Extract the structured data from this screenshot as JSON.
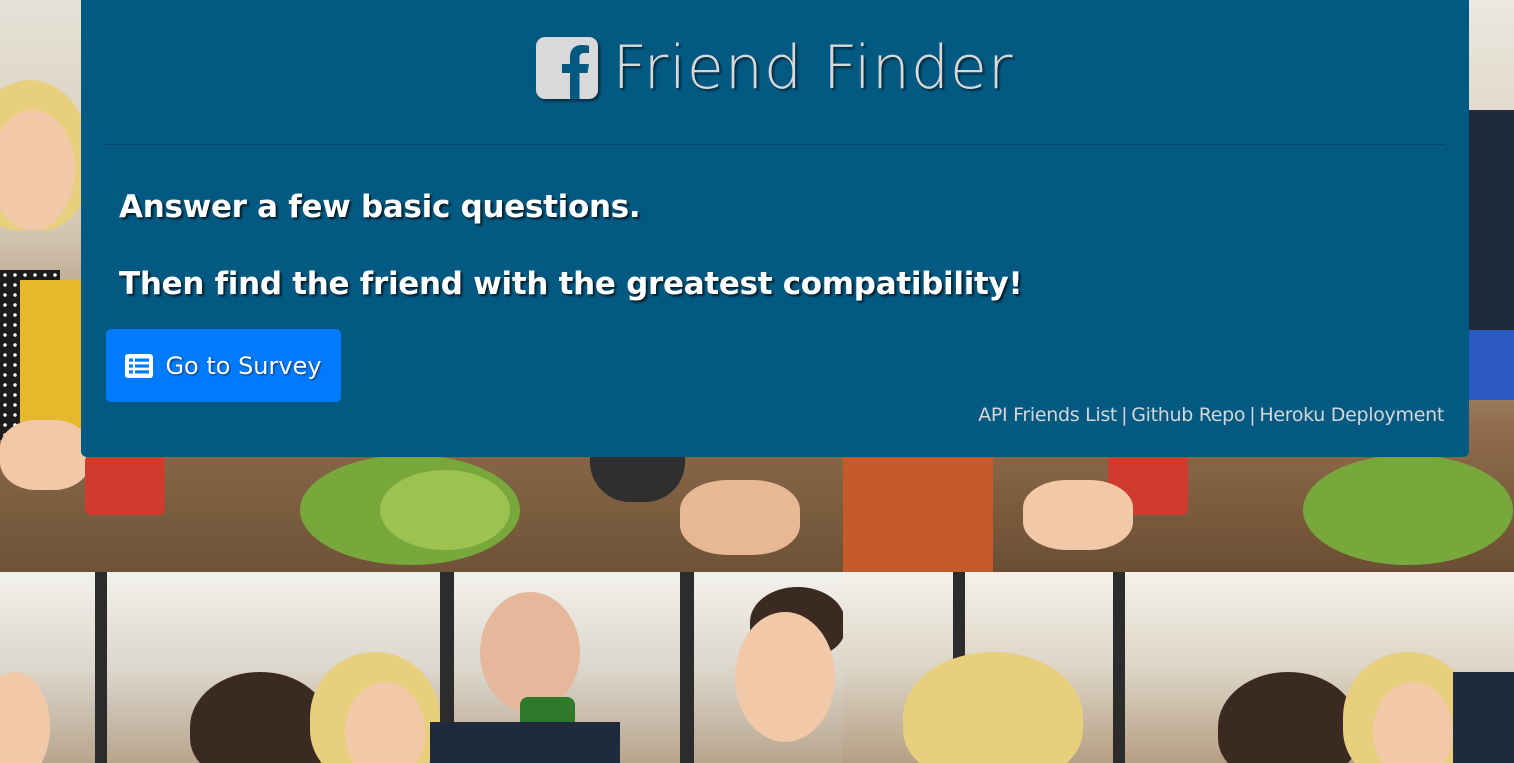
{
  "header": {
    "logo_icon": "facebook-square-icon",
    "title": "Friend Finder"
  },
  "main": {
    "lead_line_1": "Answer a few basic questions.",
    "lead_line_2": "Then find the friend with the greatest compatibility!",
    "survey_button": {
      "icon": "list-alt-icon",
      "label": "Go to Survey"
    }
  },
  "footer": {
    "links": [
      {
        "label": "API Friends List"
      },
      {
        "label": "Github Repo"
      },
      {
        "label": "Heroku Deployment"
      }
    ],
    "separator": "|"
  },
  "colors": {
    "panel_background": "#025a83",
    "button_primary": "#007bff",
    "title_text": "#d8d8d8",
    "lead_text": "#ffffff",
    "footer_text": "#d6d6d6"
  }
}
